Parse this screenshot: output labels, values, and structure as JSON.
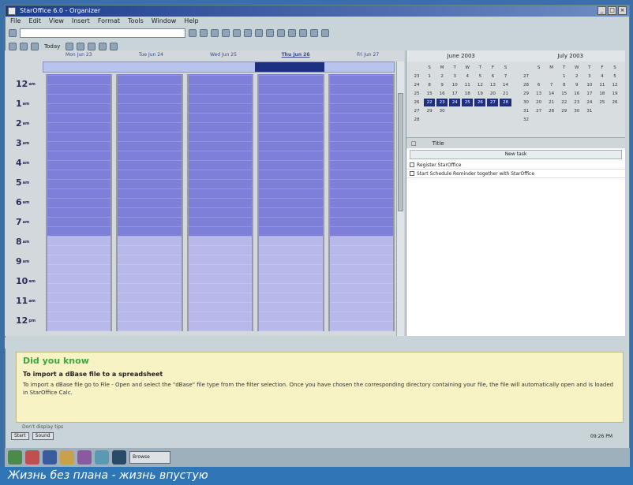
{
  "window": {
    "title": "StarOffice 6.0 - Organizer"
  },
  "menubar": {
    "items": [
      "File",
      "Edit",
      "View",
      "Insert",
      "Format",
      "Tools",
      "Window",
      "Help"
    ]
  },
  "toolbar": {
    "url_value": "",
    "today_label": "Today"
  },
  "dayview": {
    "days": [
      "Mon Jun 23",
      "Tue Jun 24",
      "Wed Jun 25",
      "Thu Jun 26",
      "Fri Jun 27"
    ],
    "selected_day": "Thu Jun 26",
    "hours": [
      "12",
      "1",
      "2",
      "3",
      "4",
      "5",
      "6",
      "7",
      "8",
      "9",
      "10",
      "11",
      "12"
    ],
    "hour_suffix": [
      "am",
      "am",
      "am",
      "am",
      "am",
      "am",
      "am",
      "am",
      "am",
      "am",
      "am",
      "am",
      "pm"
    ]
  },
  "calendar": {
    "months": [
      "June 2003",
      "July 2003"
    ],
    "weekdays": [
      "",
      "S",
      "M",
      "T",
      "W",
      "T",
      "F",
      "S"
    ],
    "june_rows": [
      [
        "23",
        "1",
        "2",
        "3",
        "4",
        "5",
        "6",
        "7"
      ],
      [
        "24",
        "8",
        "9",
        "10",
        "11",
        "12",
        "13",
        "14"
      ],
      [
        "25",
        "15",
        "16",
        "17",
        "18",
        "19",
        "20",
        "21"
      ],
      [
        "26",
        "22",
        "23",
        "24",
        "25",
        "26",
        "27",
        "28"
      ],
      [
        "27",
        "29",
        "30",
        "",
        "",
        "",
        "",
        ""
      ],
      [
        "28",
        "",
        "",
        "",
        "",
        "",
        "",
        ""
      ]
    ],
    "july_rows": [
      [
        "27",
        "",
        "",
        "1",
        "2",
        "3",
        "4",
        "5"
      ],
      [
        "28",
        "6",
        "7",
        "8",
        "9",
        "10",
        "11",
        "12"
      ],
      [
        "29",
        "13",
        "14",
        "15",
        "16",
        "17",
        "18",
        "19"
      ],
      [
        "30",
        "20",
        "21",
        "22",
        "23",
        "24",
        "25",
        "26"
      ],
      [
        "31",
        "27",
        "28",
        "29",
        "30",
        "31",
        "",
        ""
      ],
      [
        "32",
        "",
        "",
        "",
        "",
        "",
        "",
        ""
      ]
    ]
  },
  "tasks": {
    "header": "Title",
    "new_task_label": "New task",
    "items": [
      "Register StarOffice",
      "Start Schedule Reminder together with StarOffice"
    ]
  },
  "tips": {
    "title": "Did you know",
    "heading": "To import a dBase file to a spreadsheet",
    "body": "To import a dBase file go to File - Open and select the \"dBase\" file type from the filter selection. Once you have chosen the corresponding directory containing your file, the file will automatically open and is loaded in StarOffice Calc.",
    "dont_show": "Don't display tips"
  },
  "bottombar": {
    "buttons": [
      "Start",
      "Sound"
    ],
    "clock": "09:26 PM"
  },
  "taskbar": {
    "task_label": "Browse"
  },
  "caption": "Жизнь без плана - жизнь впустую",
  "colors": {
    "day_block": "#7d7fd9",
    "evening_block": "#b7b9ea",
    "selection": "#1c2f80",
    "tips_bg": "#f7f3c4",
    "tips_title": "#3ea63e",
    "caption_bg": "#2f76b6"
  }
}
